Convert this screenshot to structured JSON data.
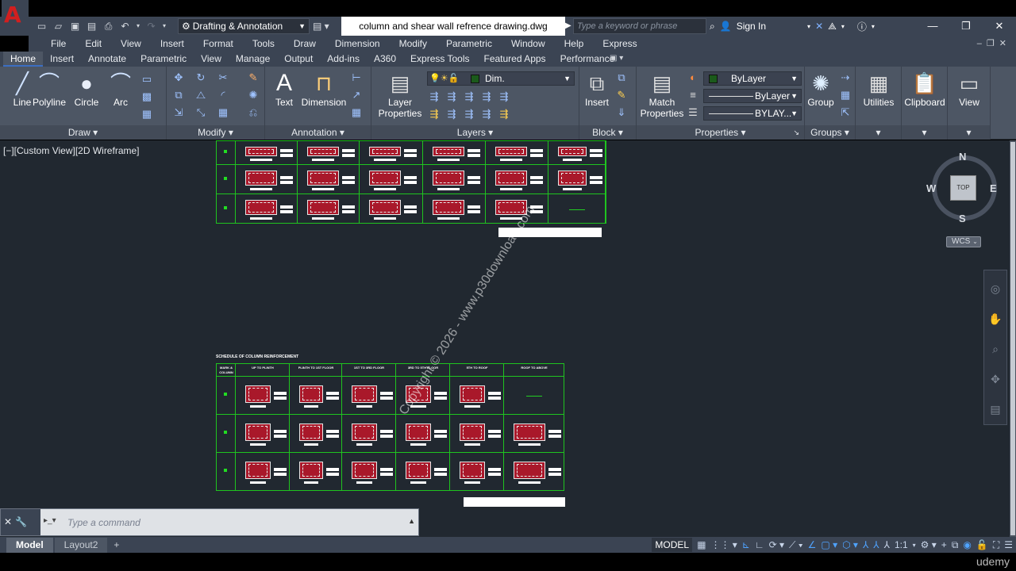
{
  "app": {
    "workspace": "Drafting & Annotation",
    "document_title": "column and shear wall refrence drawing.dwg",
    "search_placeholder": "Type a keyword or phrase",
    "sign_in": "Sign In",
    "logo": "A"
  },
  "menu": [
    "File",
    "Edit",
    "View",
    "Insert",
    "Format",
    "Tools",
    "Draw",
    "Dimension",
    "Modify",
    "Parametric",
    "Window",
    "Help",
    "Express"
  ],
  "ribbon_tabs": [
    "Home",
    "Insert",
    "Annotate",
    "Parametric",
    "View",
    "Manage",
    "Output",
    "Add-ins",
    "A360",
    "Express Tools",
    "Featured Apps",
    "Performance"
  ],
  "ribbon": {
    "draw": {
      "title": "Draw",
      "line": "Line",
      "polyline": "Polyline",
      "circle": "Circle",
      "arc": "Arc"
    },
    "modify": {
      "title": "Modify"
    },
    "annotation": {
      "title": "Annotation",
      "text": "Text",
      "dimension": "Dimension"
    },
    "layers": {
      "title": "Layers",
      "layer_properties_1": "Layer",
      "layer_properties_2": "Properties",
      "current_layer": "Dim."
    },
    "block": {
      "title": "Block",
      "insert": "Insert"
    },
    "properties": {
      "title": "Properties",
      "match_1": "Match",
      "match_2": "Properties",
      "color": "ByLayer",
      "linetype": "ByLayer",
      "lineweight": "BYLAY..."
    },
    "groups": {
      "title": "Groups",
      "group": "Group"
    },
    "utilities": "Utilities",
    "clipboard": "Clipboard",
    "view": "View"
  },
  "viewport": {
    "label": "[−][Custom View][2D Wireframe]",
    "viewcube": {
      "n": "N",
      "s": "S",
      "e": "E",
      "w": "W",
      "top": "TOP",
      "wcs": "WCS"
    }
  },
  "drawing": {
    "table2_title": "SCHEDULE OF COLUMN REINFORCEMENT",
    "table2_headers": [
      "MARK & COLUMN",
      "UP TO PLINTH",
      "PLINTH TO 1ST FLOOR",
      "1ST TO 3RD FLOOR",
      "3RD TO 5TH FLOOR",
      "5TH TO ROOF",
      "ROOF TO ABOVE"
    ]
  },
  "watermark": "Copyright © 2026 - www.p30download.com",
  "command": {
    "placeholder": "Type  a  command"
  },
  "statusbar": {
    "tabs": [
      "Model",
      "Layout2"
    ],
    "model": "MODEL",
    "scale": "1:1"
  },
  "brand": "udemy"
}
